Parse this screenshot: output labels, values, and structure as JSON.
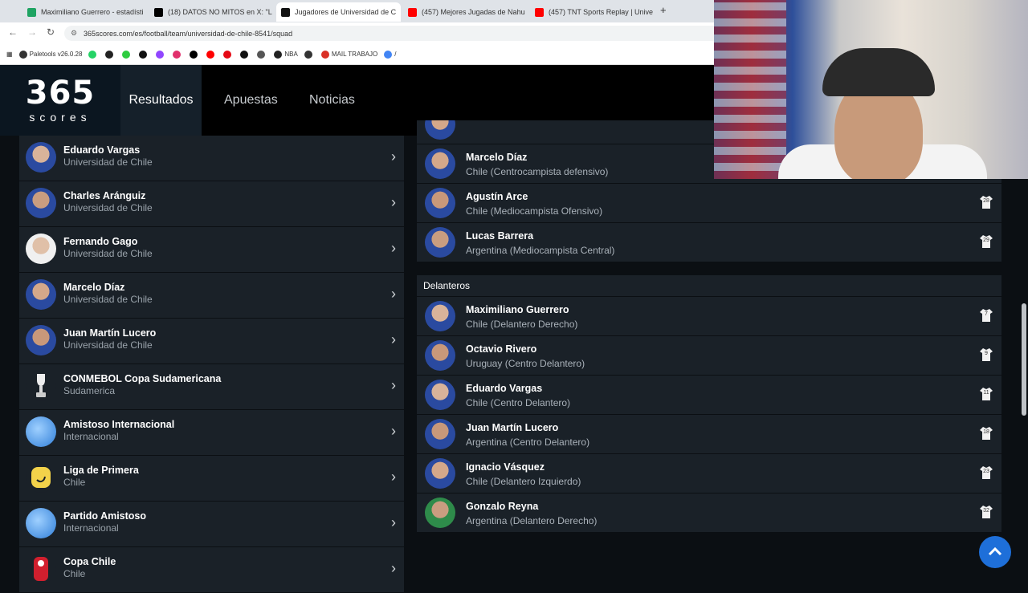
{
  "browser": {
    "tabs": [
      {
        "title": "Maximiliano Guerrero - estadísti",
        "fav_color": "#1ea362"
      },
      {
        "title": "(18) DATOS NO MITOS en X: \"L",
        "fav_color": "#000000"
      },
      {
        "title": "Jugadores de Universidad de C",
        "fav_color": "#111111"
      },
      {
        "title": "(457) Mejores Jugadas de Nahu",
        "fav_color": "#ff0000"
      },
      {
        "title": "(457) TNT Sports Replay | Unive",
        "fav_color": "#ff0000"
      }
    ],
    "url": "365scores.com/es/football/team/universidad-de-chile-8541/squad",
    "bookmarks": [
      "Paletools v26.0.28",
      "NBA",
      "MAIL TRABAJO"
    ]
  },
  "site": {
    "logo_big": "365",
    "logo_small": "scores",
    "nav": [
      "Resultados",
      "Apuestas",
      "Noticias"
    ]
  },
  "left_list": [
    {
      "name": "Eduardo Vargas",
      "sub": "Universidad de Chile",
      "icon": "player-avatar"
    },
    {
      "name": "Charles Aránguiz",
      "sub": "Universidad de Chile",
      "icon": "player-avatar"
    },
    {
      "name": "Fernando Gago",
      "sub": "Universidad de Chile",
      "icon": "player-avatar"
    },
    {
      "name": "Marcelo Díaz",
      "sub": "Universidad de Chile",
      "icon": "player-avatar"
    },
    {
      "name": "Juan Martín Lucero",
      "sub": "Universidad de Chile",
      "icon": "player-avatar"
    },
    {
      "name": "CONMEBOL Copa Sudamericana",
      "sub": "Sudamerica",
      "icon": "trophy-icon"
    },
    {
      "name": "Amistoso Internacional",
      "sub": "Internacional",
      "icon": "globe-icon"
    },
    {
      "name": "Liga de Primera",
      "sub": "Chile",
      "icon": "league-icon"
    },
    {
      "name": "Partido Amistoso",
      "sub": "Internacional",
      "icon": "globe-icon"
    },
    {
      "name": "Copa Chile",
      "sub": "Chile",
      "icon": "copa-chile-icon"
    }
  ],
  "midfield_partial": [
    {
      "name": "Marcelo Díaz",
      "sub": "Chile (Centrocampista defensivo)",
      "number": ""
    },
    {
      "name": "Agustín Arce",
      "sub": "Chile (Mediocampista Ofensivo)",
      "number": "28"
    },
    {
      "name": "Lucas Barrera",
      "sub": "Argentina (Mediocampista Central)",
      "number": "29"
    }
  ],
  "forwards_title": "Delanteros",
  "forwards": [
    {
      "name": "Maximiliano Guerrero",
      "sub": "Chile (Delantero Derecho)",
      "number": "7"
    },
    {
      "name": "Octavio Rivero",
      "sub": "Uruguay (Centro Delantero)",
      "number": "9"
    },
    {
      "name": "Eduardo Vargas",
      "sub": "Chile (Centro Delantero)",
      "number": "11"
    },
    {
      "name": "Juan Martín Lucero",
      "sub": "Argentina (Centro Delantero)",
      "number": "18"
    },
    {
      "name": "Ignacio Vásquez",
      "sub": "Chile (Delantero Izquierdo)",
      "number": "23"
    },
    {
      "name": "Gonzalo Reyna",
      "sub": "Argentina (Delantero Derecho)",
      "number": "32"
    }
  ],
  "colors": {
    "accent": "#1e6fd9",
    "row_bg": "#1a2128",
    "page_bg": "#0b0f13"
  }
}
